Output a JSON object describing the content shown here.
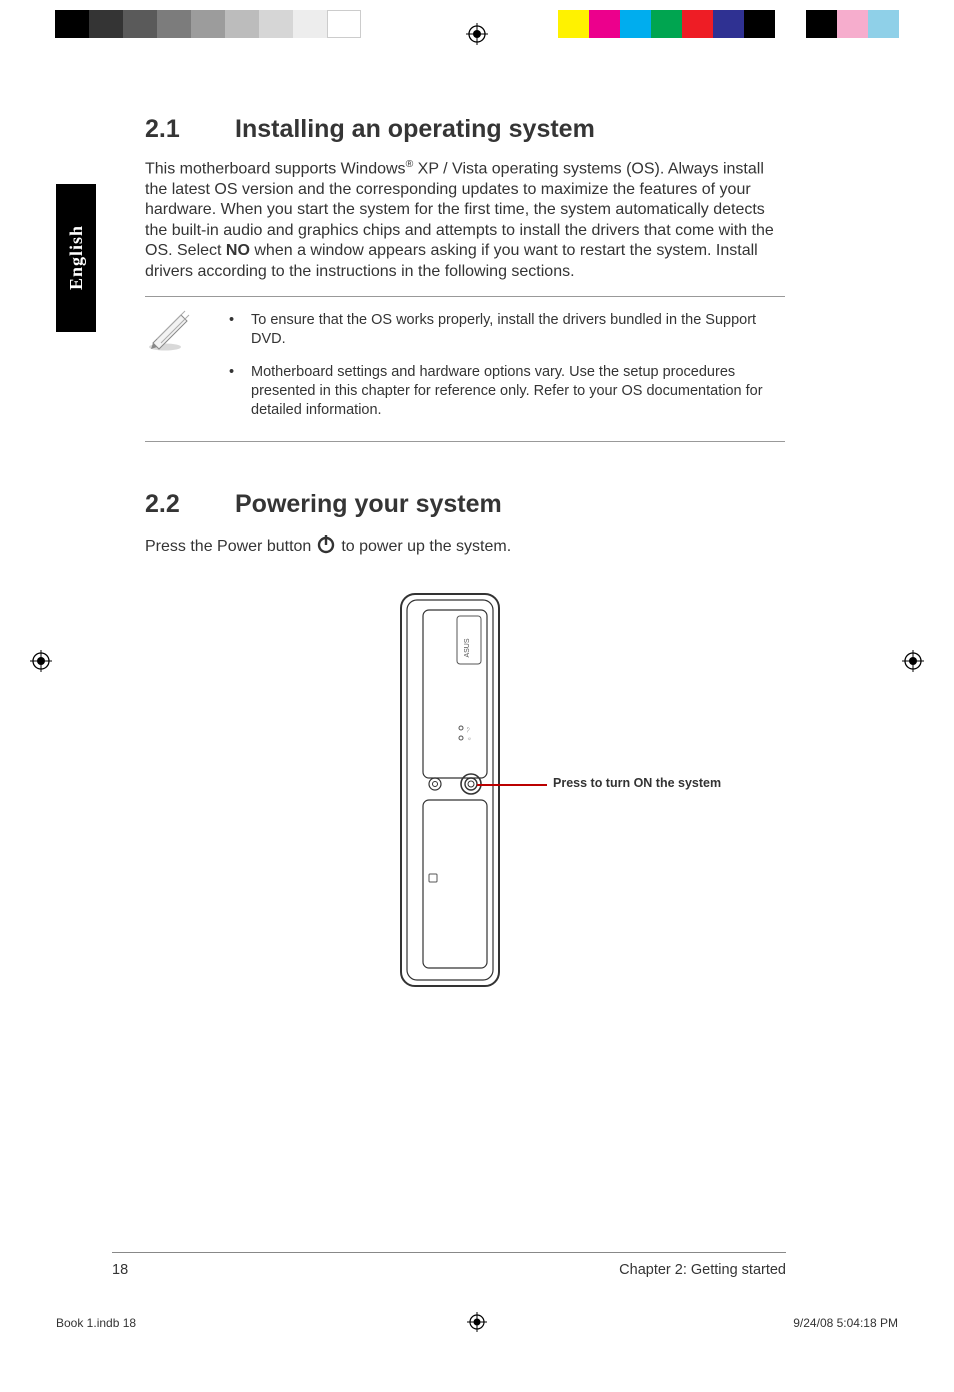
{
  "language_tab": "English",
  "top_marks": {
    "grays": [
      "#000000",
      "#343434",
      "#5a5a5a",
      "#7c7c7c",
      "#9c9c9c",
      "#bcbcbc",
      "#d6d6d6",
      "#ededed",
      "#ffffff"
    ],
    "colors": [
      "#fff200",
      "#ec008c",
      "#00adee",
      "#00a550",
      "#ee1d25",
      "#2f3192",
      "#000000",
      "#ffffff",
      "#000000",
      "#f6adcd",
      "#8fd0e8"
    ]
  },
  "section_21": {
    "number": "2.1",
    "title": "Installing an operating system",
    "body_parts": {
      "p1a": "This motherboard supports Windows",
      "reg": "®",
      "p1b": " XP / Vista operating systems (OS). Always install the latest OS version and the corresponding updates to maximize the features of your hardware. When you start the system for the first time, the system automatically detects the built-in audio and graphics chips and attempts to install the drivers that come with the OS. Select ",
      "no": "NO",
      "p1c": " when a window appears asking if you want to restart the system. Install drivers according to the instructions in the following sections."
    },
    "notes": [
      "To ensure that the OS works properly, install the drivers bundled in the Support DVD.",
      "Motherboard settings and hardware options vary. Use the setup procedures presented in this chapter for reference only. Refer to your OS documentation for detailed information."
    ]
  },
  "section_22": {
    "number": "2.2",
    "title": "Powering your system",
    "line_a": "Press the Power button ",
    "line_b": " to power up the system.",
    "callout": "Press to turn ON the system"
  },
  "footer": {
    "page": "18",
    "chapter": "Chapter 2: Getting started"
  },
  "imprint": {
    "left": "Book 1.indb   18",
    "right": "9/24/08   5:04:18 PM"
  }
}
